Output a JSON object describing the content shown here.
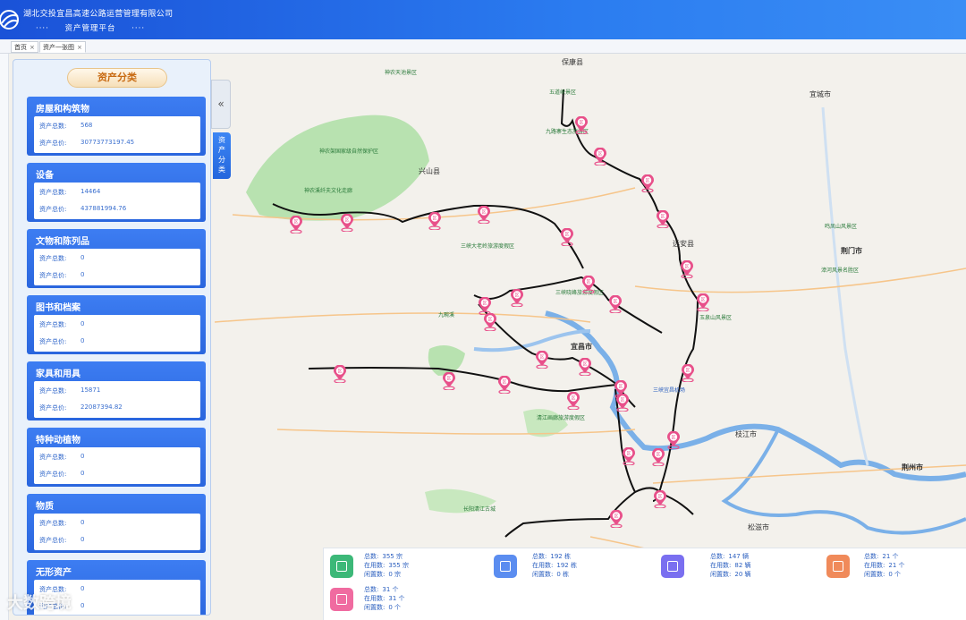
{
  "header": {
    "company": "湖北交投宜昌高速公路运营管理有限公司",
    "platform": "资产管理平台",
    "dots_left": "····",
    "dots_right": "····"
  },
  "tabs": [
    {
      "label": "首页",
      "close": "×"
    },
    {
      "label": "资产一张图",
      "close": "×"
    }
  ],
  "panel": {
    "title": "资产分类",
    "collapse_icon": "«",
    "side_tab": "资产分类",
    "categories": [
      {
        "name": "房屋和构筑物",
        "count_label": "资产总数:",
        "count": "568",
        "value_label": "资产总价:",
        "value": "30773773197.45"
      },
      {
        "name": "设备",
        "count_label": "资产总数:",
        "count": "14464",
        "value_label": "资产总价:",
        "value": "437881994.76"
      },
      {
        "name": "文物和陈列品",
        "count_label": "资产总数:",
        "count": "0",
        "value_label": "资产总价:",
        "value": "0"
      },
      {
        "name": "图书和档案",
        "count_label": "资产总数:",
        "count": "0",
        "value_label": "资产总价:",
        "value": "0"
      },
      {
        "name": "家具和用具",
        "count_label": "资产总数:",
        "count": "15871",
        "value_label": "资产总价:",
        "value": "22087394.82"
      },
      {
        "name": "特种动植物",
        "count_label": "资产总数:",
        "count": "0",
        "value_label": "资产总价:",
        "value": "0"
      },
      {
        "name": "物质",
        "count_label": "资产总数:",
        "count": "0",
        "value_label": "资产总价:",
        "value": "0"
      },
      {
        "name": "无形资产",
        "count_label": "资产总数:",
        "count": "0",
        "value_label": "资产总价:",
        "value": "0"
      }
    ]
  },
  "stats": [
    {
      "icon": "building-icon",
      "color": "#3cb878",
      "total_label": "总数:",
      "total": "355 宗",
      "use_label": "在用数:",
      "use": "355 宗",
      "idle_label": "闲置数:",
      "idle": "0 宗"
    },
    {
      "icon": "house-icon",
      "color": "#5b8df0",
      "total_label": "总数:",
      "total": "192 栋",
      "use_label": "在用数:",
      "use": "192 栋",
      "idle_label": "闲置数:",
      "idle": "0 栋"
    },
    {
      "icon": "car-icon",
      "color": "#7a6ff0",
      "total_label": "总数:",
      "total": "147 辆",
      "use_label": "在用数:",
      "use": "82 辆",
      "idle_label": "闲置数:",
      "idle": "20 辆"
    },
    {
      "icon": "box-icon",
      "color": "#f08a5a",
      "total_label": "总数:",
      "total": "21 个",
      "use_label": "在用数:",
      "use": "21 个",
      "idle_label": "闲置数:",
      "idle": "0 个"
    },
    {
      "icon": "service-area-icon",
      "color": "#f06ba0",
      "total_label": "总数:",
      "total": "31 个",
      "use_label": "在用数:",
      "use": "31 个",
      "idle_label": "闲置数:",
      "idle": "0 个"
    }
  ],
  "map": {
    "cities": [
      "保康县",
      "兴山县",
      "远安县",
      "宜昌市",
      "荆门市",
      "枝江市",
      "荆州市",
      "松滋市",
      "宜城市"
    ],
    "places": [
      "神农天池景区",
      "五道峡景区",
      "九路寨生态旅游区",
      "三峡大老岭旅游度假区",
      "三峡晓峰旅游度假区",
      "九畹溪",
      "清江画廊旅游度假区",
      "三峡宜昌机场",
      "鸣凤山风景区",
      "漳河风景名胜区",
      "玉泉山风景区",
      "神农架国家级自然保护区",
      "神农溪纤夫文化走廊",
      "长阳清江古城"
    ],
    "marker_count": 30,
    "marker_glyph": "区",
    "colors": {
      "route": "#111111",
      "marker": "#e8508a",
      "water": "#7ab0e8",
      "forest": "#b8e2b0"
    }
  },
  "watermark": "大数跨境"
}
